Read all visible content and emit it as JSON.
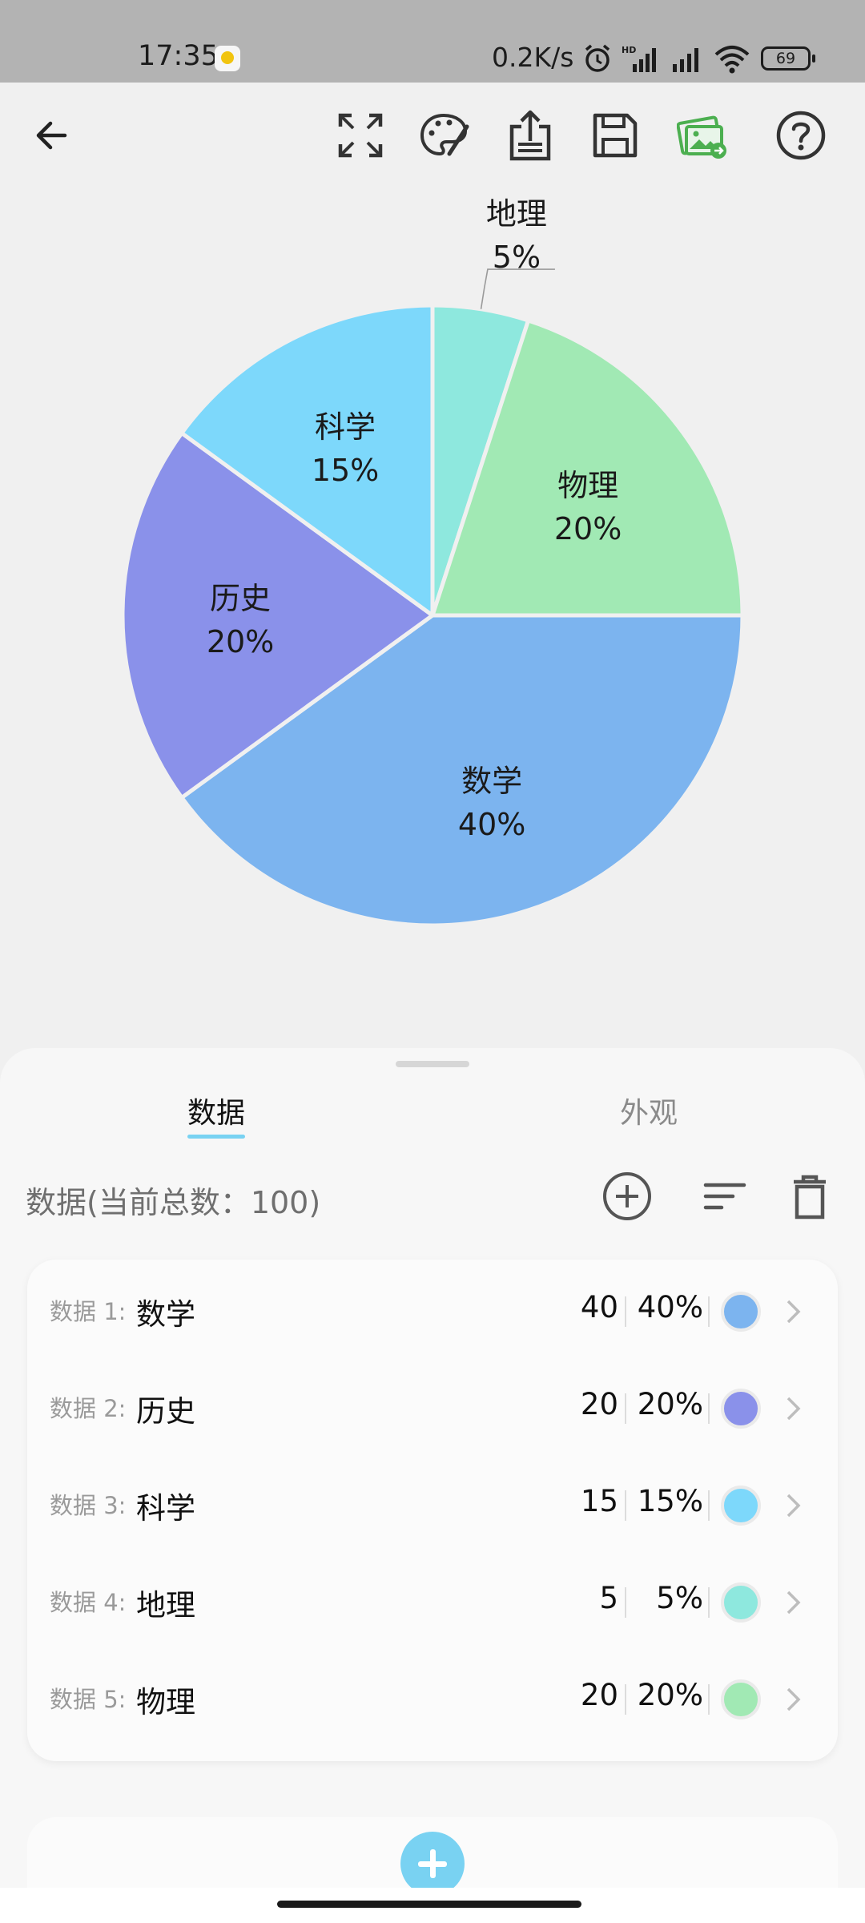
{
  "status_bar": {
    "time": "17:35",
    "network_speed": "0.2K/s",
    "battery": "69",
    "icons": [
      "notification-icon",
      "alarm-icon",
      "hd-signal-icon",
      "signal-icon",
      "wifi-icon",
      "battery-icon"
    ]
  },
  "toolbar": {
    "icons": [
      "back-arrow-icon",
      "fullscreen-icon",
      "palette-icon",
      "share-icon",
      "save-icon",
      "export-image-icon",
      "help-icon"
    ],
    "accent_color": "#4caf50"
  },
  "chart_data": {
    "type": "pie",
    "start_angle_deg": 0,
    "direction": "clockwise",
    "slices": [
      {
        "label": "数学",
        "value": 40,
        "percent": "40%",
        "color": "#7cb4ef"
      },
      {
        "label": "历史",
        "value": 20,
        "percent": "20%",
        "color": "#8a91ea"
      },
      {
        "label": "科学",
        "value": 15,
        "percent": "15%",
        "color": "#7dd8fb"
      },
      {
        "label": "地理",
        "value": 5,
        "percent": "5%",
        "color": "#8ee8de"
      },
      {
        "label": "物理",
        "value": 20,
        "percent": "20%",
        "color": "#a1e9b4"
      }
    ]
  },
  "sheet": {
    "tabs": [
      {
        "label": "数据",
        "active": true
      },
      {
        "label": "外观",
        "active": false
      }
    ],
    "summary": "数据(当前总数：100)",
    "actions": [
      "add-circle-icon",
      "sort-icon",
      "delete-icon"
    ],
    "rows": [
      {
        "index": "数据 1:",
        "name": "数学",
        "value": "40",
        "percent": "40%",
        "color": "#7cb4ef"
      },
      {
        "index": "数据 2:",
        "name": "历史",
        "value": "20",
        "percent": "20%",
        "color": "#8a91ea"
      },
      {
        "index": "数据 3:",
        "name": "科学",
        "value": "15",
        "percent": "15%",
        "color": "#7dd8fb"
      },
      {
        "index": "数据 4:",
        "name": "地理",
        "value": "5",
        "percent": "5%",
        "color": "#8ee8de"
      },
      {
        "index": "数据 5:",
        "name": "物理",
        "value": "20",
        "percent": "20%",
        "color": "#a1e9b4"
      }
    ],
    "accent_color": "#79d2f2"
  }
}
